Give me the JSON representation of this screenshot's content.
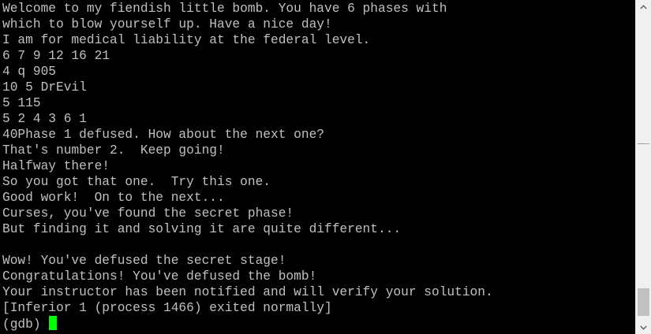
{
  "terminal": {
    "lines": [
      "Welcome to my fiendish little bomb. You have 6 phases with",
      "which to blow yourself up. Have a nice day!",
      "I am for medical liability at the federal level.",
      "6 7 9 12 16 21",
      "4 q 905",
      "10 5 DrEvil",
      "5 115",
      "5 2 4 3 6 1",
      "40Phase 1 defused. How about the next one?",
      "That's number 2.  Keep going!",
      "Halfway there!",
      "So you got that one.  Try this one.",
      "Good work!  On to the next...",
      "Curses, you've found the secret phase!",
      "But finding it and solving it are quite different...",
      "",
      "Wow! You've defused the secret stage!",
      "Congratulations! You've defused the bomb!",
      "Your instructor has been notified and will verify your solution.",
      "[Inferior 1 (process 1466) exited normally]"
    ],
    "prompt": "(gdb) "
  },
  "scrollbar": {
    "up_icon": "chevron-up-icon",
    "down_icon": "chevron-down-icon",
    "position_fraction": 1.0
  },
  "colors": {
    "background": "#000000",
    "text": "#c0c0c0",
    "cursor": "#00ff00"
  }
}
